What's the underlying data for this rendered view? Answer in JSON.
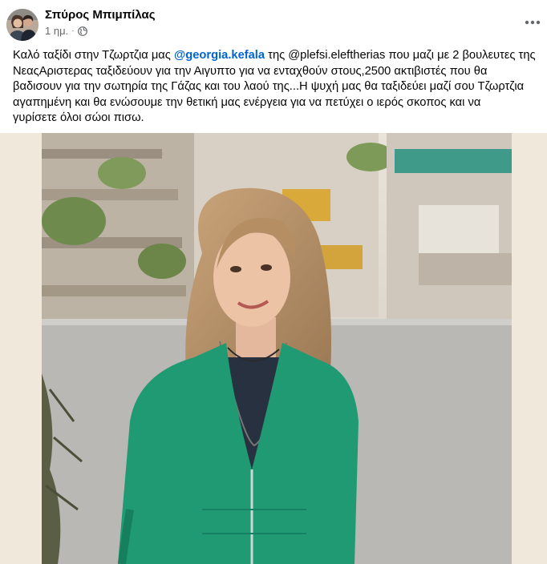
{
  "post": {
    "author": "Σπύρος Μπιμπίλας",
    "time": "1 ημ.",
    "separator": "·",
    "privacy_icon": "globe-icon",
    "more_icon": "more-options-icon",
    "text_lines": [
      {
        "before": "Καλό ταξίδι στην Τζωρτζια μας ",
        "mention": "@georgia.kefala",
        "after": " της @plefsi.eleftherias που μαζι με 2 βουλευτες της"
      },
      {
        "text": "ΝεαςΑριστερας ταξιδεύουν για την Αιγυπτο για να ενταχθούν στους,2500 ακτιβιστές που θα"
      },
      {
        "text": "βαδισουν για την σωτηρία της Γάζας και του λαού της...Η ψυχή μας θα ταξιδεύει μαζί σου Τζωρτζια"
      },
      {
        "text": "αγαπημένη και θα ενώσουμε την θετική μας ενέργεια για να πετύχει ο ιερός σκοπος και να"
      },
      {
        "text": "γυρίσετε όλοι σώοι πισω."
      }
    ]
  },
  "colors": {
    "author_text": "#050505",
    "meta_text": "#65676b",
    "mention": "#0064d1",
    "media_background": "#f1e8dc",
    "sweater": "#1f9a72"
  }
}
